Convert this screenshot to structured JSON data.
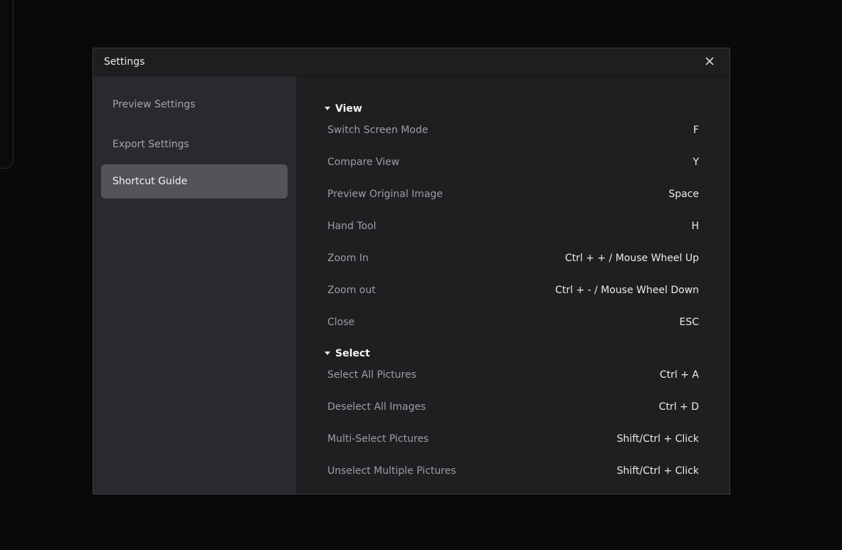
{
  "dialog": {
    "title": "Settings",
    "close_icon": "close-icon"
  },
  "sidebar": {
    "items": [
      {
        "label": "Preview Settings",
        "active": false
      },
      {
        "label": "Export Settings",
        "active": false
      },
      {
        "label": "Shortcut Guide",
        "active": true
      }
    ]
  },
  "shortcuts": {
    "sections": [
      {
        "title": "View",
        "expanded": true,
        "rows": [
          {
            "action": "Switch Screen Mode",
            "keys": "F"
          },
          {
            "action": "Compare View",
            "keys": "Y"
          },
          {
            "action": "Preview Original Image",
            "keys": "Space"
          },
          {
            "action": "Hand Tool",
            "keys": "H"
          },
          {
            "action": "Zoom In",
            "keys": "Ctrl + + / Mouse Wheel Up"
          },
          {
            "action": "Zoom out",
            "keys": "Ctrl + - / Mouse Wheel Down"
          },
          {
            "action": "Close",
            "keys": "ESC"
          }
        ]
      },
      {
        "title": "Select",
        "expanded": true,
        "rows": [
          {
            "action": "Select All Pictures",
            "keys": "Ctrl + A"
          },
          {
            "action": "Deselect All Images",
            "keys": "Ctrl + D"
          },
          {
            "action": "Multi-Select Pictures",
            "keys": "Shift/Ctrl + Click"
          },
          {
            "action": "Unselect Multiple Pictures",
            "keys": "Shift/Ctrl + Click"
          }
        ]
      }
    ]
  },
  "colors": {
    "background": "#090909",
    "dialog": "#1f1f22",
    "sidebar": "#2a2a2e",
    "active_item": "#53535a"
  }
}
